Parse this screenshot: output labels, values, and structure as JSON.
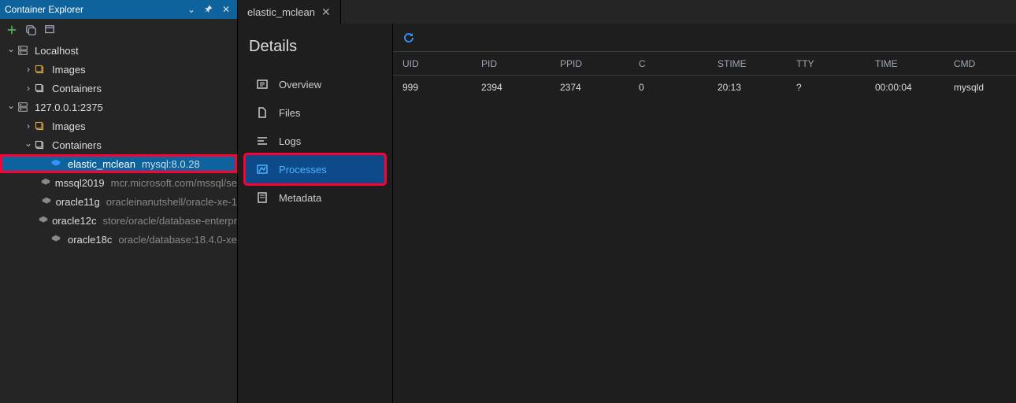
{
  "sidebar": {
    "title": "Container Explorer",
    "hosts": [
      {
        "name": "Localhost",
        "expanded": true,
        "children": [
          {
            "kind": "images",
            "label": "Images",
            "expanded": false
          },
          {
            "kind": "containers",
            "label": "Containers",
            "expanded": false
          }
        ]
      },
      {
        "name": "127.0.0.1:2375",
        "expanded": true,
        "children": [
          {
            "kind": "images",
            "label": "Images",
            "expanded": false
          },
          {
            "kind": "containers",
            "label": "Containers",
            "expanded": true,
            "containers": [
              {
                "name": "elastic_mclean",
                "image": "mysql:8.0.28",
                "selected": true,
                "running": true
              },
              {
                "name": "mssql2019",
                "image": "mcr.microsoft.com/mssql/se",
                "running": false
              },
              {
                "name": "oracle11g",
                "image": "oracleinanutshell/oracle-xe-1",
                "running": false
              },
              {
                "name": "oracle12c",
                "image": "store/oracle/database-enterpr",
                "running": false
              },
              {
                "name": "oracle18c",
                "image": "oracle/database:18.4.0-xe",
                "running": false
              }
            ]
          }
        ]
      }
    ]
  },
  "tab": {
    "title": "elastic_mclean"
  },
  "details": {
    "title": "Details",
    "items": [
      {
        "id": "overview",
        "label": "Overview"
      },
      {
        "id": "files",
        "label": "Files"
      },
      {
        "id": "logs",
        "label": "Logs"
      },
      {
        "id": "processes",
        "label": "Processes",
        "selected": true
      },
      {
        "id": "metadata",
        "label": "Metadata"
      }
    ]
  },
  "process_table": {
    "headers": [
      "UID",
      "PID",
      "PPID",
      "C",
      "STIME",
      "TTY",
      "TIME",
      "CMD"
    ],
    "rows": [
      {
        "uid": "999",
        "pid": "2394",
        "ppid": "2374",
        "c": "0",
        "stime": "20:13",
        "tty": "?",
        "time": "00:00:04",
        "cmd": "mysqld"
      }
    ]
  }
}
